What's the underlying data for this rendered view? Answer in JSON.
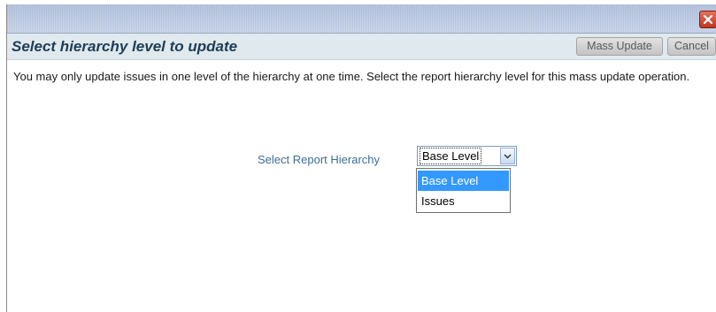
{
  "dialog": {
    "close_icon": "close-x-icon",
    "close_color": "#c94a34"
  },
  "header": {
    "title": "Select hierarchy level to update",
    "mass_update_label": "Mass Update",
    "cancel_label": "Cancel"
  },
  "body": {
    "description": "You may only update issues in one level of the hierarchy at one time. Select the report hierarchy level for this mass update operation.",
    "hierarchy_label": "Select Report Hierarchy",
    "hierarchy_selected": "Base Level",
    "hierarchy_options": [
      "Base Level",
      "Issues"
    ]
  },
  "colors": {
    "header_background": "#dfe9ee",
    "title_text": "#1f3d55",
    "label_text": "#3b6e96",
    "selected_option": "#3399ff"
  }
}
